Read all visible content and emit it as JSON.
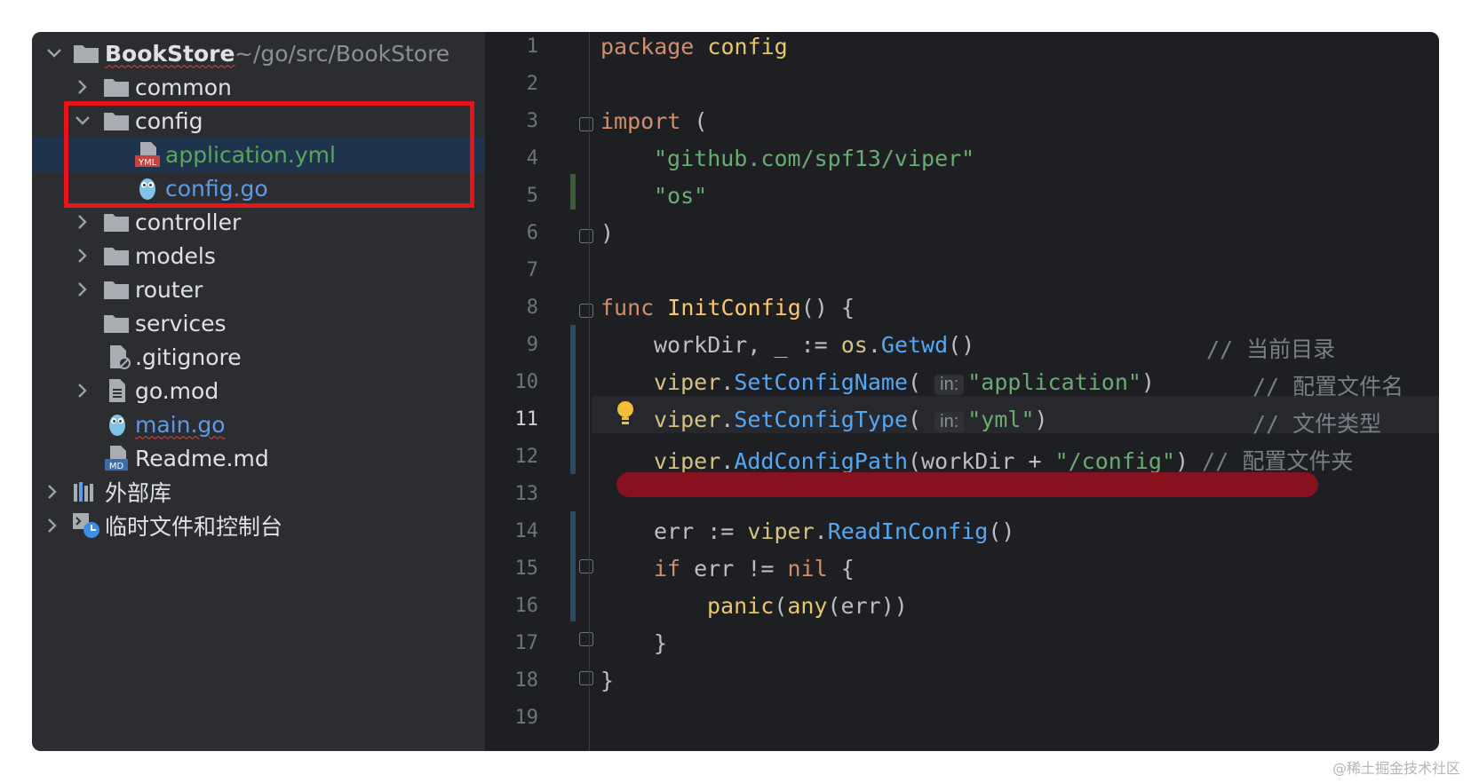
{
  "project": {
    "root_name": "BookStore",
    "root_path": "~/go/src/BookStore",
    "items": [
      {
        "label": "common",
        "kind": "folder"
      },
      {
        "label": "config",
        "kind": "folder"
      },
      {
        "label": "application.yml",
        "kind": "yml-file"
      },
      {
        "label": "config.go",
        "kind": "go-file"
      },
      {
        "label": "controller",
        "kind": "folder"
      },
      {
        "label": "models",
        "kind": "folder"
      },
      {
        "label": "router",
        "kind": "folder"
      },
      {
        "label": "services",
        "kind": "folder"
      },
      {
        "label": ".gitignore",
        "kind": "ignore-file"
      },
      {
        "label": "go.mod",
        "kind": "mod-file"
      },
      {
        "label": "main.go",
        "kind": "go-file"
      },
      {
        "label": "Readme.md",
        "kind": "md-file"
      }
    ],
    "external_libs": "外部库",
    "scratches": "临时文件和控制台",
    "file_icon_labels": {
      "yml": "YML",
      "md": "MD"
    }
  },
  "editor": {
    "line_numbers": [
      "1",
      "2",
      "3",
      "4",
      "5",
      "6",
      "7",
      "8",
      "9",
      "10",
      "11",
      "12",
      "13",
      "14",
      "15",
      "16",
      "17",
      "18",
      "19"
    ],
    "current_line": "11",
    "code": {
      "l1_kw": "package",
      "l1_name": "config",
      "l3_kw": "import",
      "l3_paren": " (",
      "l4_str": "\"github.com/spf13/viper\"",
      "l5_str": "\"os\"",
      "l6": ")",
      "l8_kw": "func",
      "l8_name": "InitConfig",
      "l8_rest": "() {",
      "l9_var": "workDir, _ := ",
      "l9_pkg": "os",
      "l9_dot": ".",
      "l9_fn": "Getwd",
      "l9_rest": "()",
      "l9_cmt": "// 当前目录",
      "l10_pkg": "viper",
      "l10_dot": ".",
      "l10_fn": "SetConfigName",
      "l10_open": "(",
      "l10_hint": "in:",
      "l10_str": "\"application\"",
      "l10_close": ")",
      "l10_cmt": "// 配置文件名",
      "l11_pkg": "viper",
      "l11_dot": ".",
      "l11_fn": "SetConfigType",
      "l11_open": "(",
      "l11_hint": "in:",
      "l11_str": "\"yml\"",
      "l11_close": ")",
      "l11_cmt": "// 文件类型",
      "l12_pkg": "viper",
      "l12_dot": ".",
      "l12_fn": "AddConfigPath",
      "l12_open": "(workDir + ",
      "l12_str": "\"/config\"",
      "l12_close": ")",
      "l12_cmt": "// 配置文件夹",
      "l14_var": "err := ",
      "l14_pkg": "viper",
      "l14_dot": ".",
      "l14_fn": "ReadInConfig",
      "l14_rest": "()",
      "l15_kw": "if",
      "l15_mid": " err != ",
      "l15_nil": "nil",
      "l15_rest": " {",
      "l16_fn": "panic",
      "l16_open": "(",
      "l16_any": "any",
      "l16_rest": "(err))",
      "l17": "}",
      "l18": "}"
    }
  },
  "watermark": "@稀土掘金技术社区",
  "colors": {
    "highlight_box": "#e8141a",
    "redbar": "#87111e",
    "selection": "#1f334d"
  }
}
